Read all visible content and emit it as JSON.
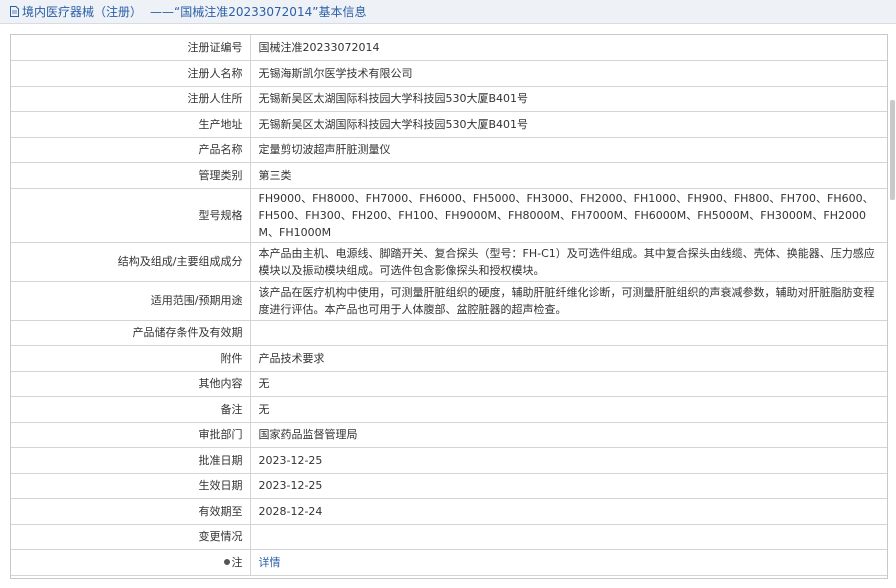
{
  "header": {
    "section": "境内医疗器械（注册）",
    "dash": "——",
    "record": "“国械注准20233072014”",
    "suffix": "基本信息"
  },
  "rows": [
    {
      "label": "注册证编号",
      "value": "国械注准20233072014"
    },
    {
      "label": "注册人名称",
      "value": "无锡海斯凯尔医学技术有限公司"
    },
    {
      "label": "注册人住所",
      "value": "无锡新吴区太湖国际科技园大学科技园530大厦B401号"
    },
    {
      "label": "生产地址",
      "value": "无锡新吴区太湖国际科技园大学科技园530大厦B401号"
    },
    {
      "label": "产品名称",
      "value": "定量剪切波超声肝脏测量仪"
    },
    {
      "label": "管理类别",
      "value": "第三类"
    },
    {
      "label": "型号规格",
      "value": "FH9000、FH8000、FH7000、FH6000、FH5000、FH3000、FH2000、FH1000、FH900、FH800、FH700、FH600、FH500、FH300、FH200、FH100、FH9000M、FH8000M、FH7000M、FH6000M、FH5000M、FH3000M、FH2000M、FH1000M"
    },
    {
      "label": "结构及组成/主要组成成分",
      "value": "本产品由主机、电源线、脚踏开关、复合探头（型号：FH-C1）及可选件组成。其中复合探头由线缆、壳体、换能器、压力感应模块以及振动模块组成。可选件包含影像探头和授权模块。"
    },
    {
      "label": "适用范围/预期用途",
      "value": "该产品在医疗机构中使用，可测量肝脏组织的硬度，辅助肝脏纤维化诊断，可测量肝脏组织的声衰减参数，辅助对肝脏脂肪变程度进行评估。本产品也可用于人体腹部、盆腔脏器的超声检查。"
    },
    {
      "label": "产品储存条件及有效期",
      "value": ""
    },
    {
      "label": "附件",
      "value": "产品技术要求"
    },
    {
      "label": "其他内容",
      "value": "无"
    },
    {
      "label": "备注",
      "value": "无"
    },
    {
      "label": "审批部门",
      "value": "国家药品监督管理局"
    },
    {
      "label": "批准日期",
      "value": "2023-12-25"
    },
    {
      "label": "生效日期",
      "value": "2023-12-25"
    },
    {
      "label": "有效期至",
      "value": "2028-12-24"
    },
    {
      "label": "变更情况",
      "value": ""
    }
  ],
  "note_row": {
    "label": "注",
    "link": "详情"
  }
}
